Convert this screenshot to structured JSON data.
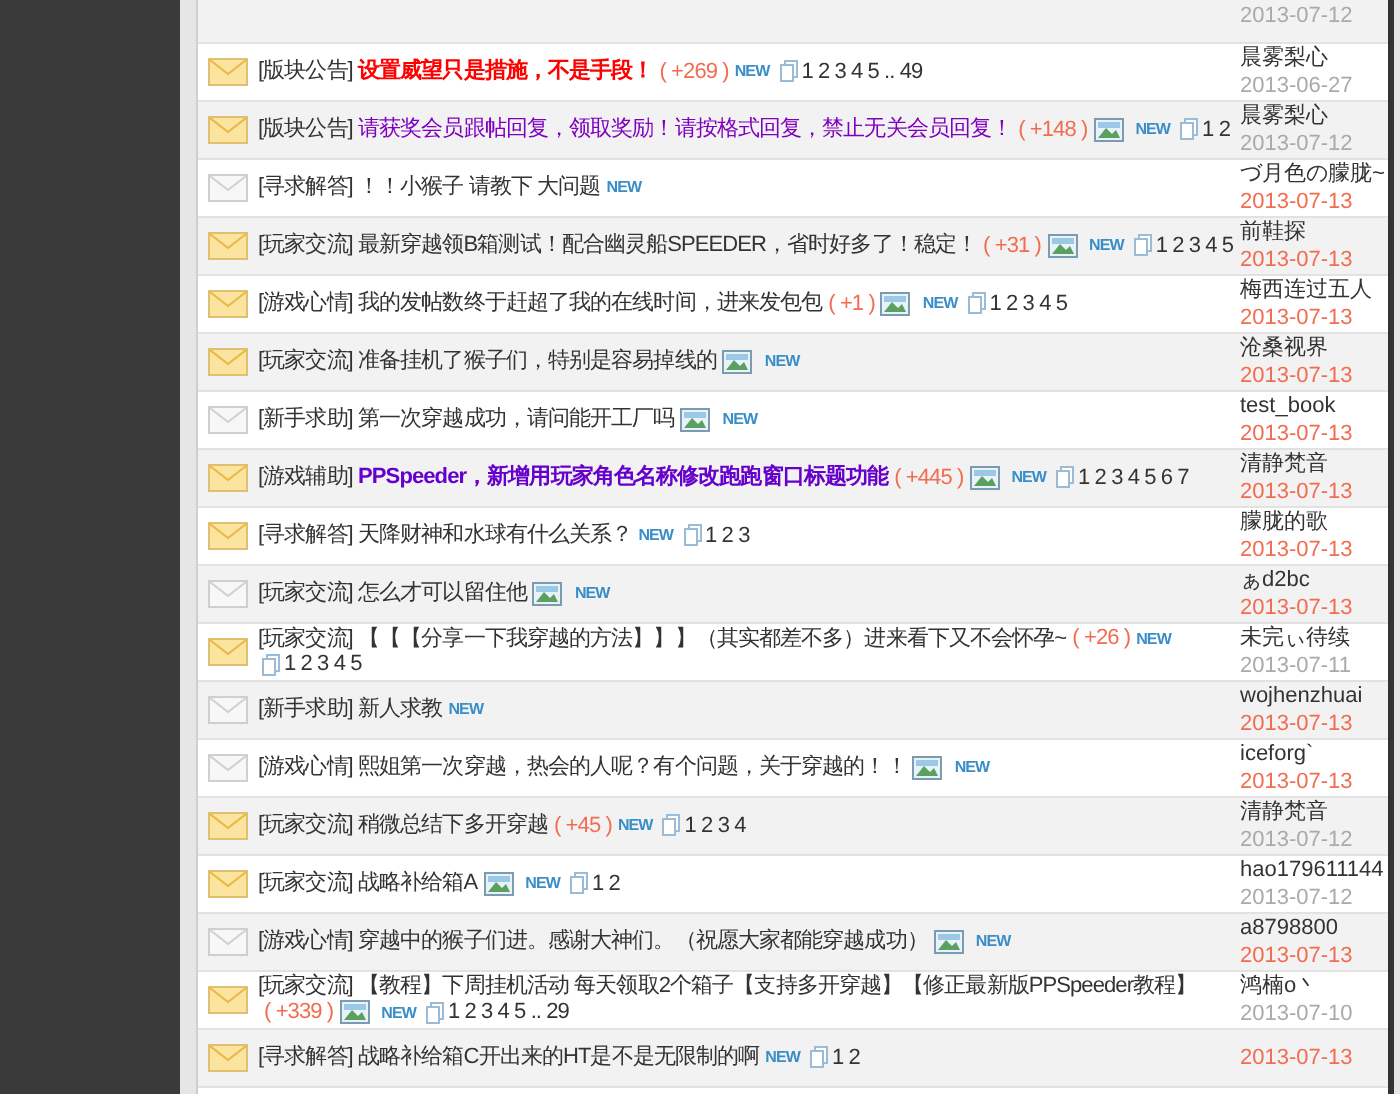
{
  "threads": [
    {
      "kind": "partial",
      "date": "2013-07-12",
      "recent": false
    },
    {
      "kind": "hot",
      "category": "[版块公告]",
      "title": "设置威望只是措施，不是手段！",
      "color": "#ff0000",
      "bold": true,
      "reward": "( +269 )",
      "new": "NEW",
      "pages": "1 2 3 4 5 .. 49",
      "author": "晨雾梨心",
      "date": "2013-06-27",
      "recent": false
    },
    {
      "kind": "hot",
      "category": "[版块公告]",
      "title": "请获奖会员跟帖回复，领取奖励！请按格式回复，禁止无关会员回复！",
      "color": "#8000c0",
      "reward": "( +148 )",
      "image": true,
      "new": "NEW",
      "pages": "1 2",
      "author": "晨雾梨心",
      "date": "2013-07-12",
      "recent": false
    },
    {
      "kind": "plain",
      "category": "[寻求解答]",
      "title": "！！小猴子 请教下 大问题",
      "color": "#333333",
      "new": "NEW",
      "author": "づ月色の朦胧~",
      "date": "2013-07-13",
      "recent": true
    },
    {
      "kind": "hot",
      "category": "[玩家交流]",
      "title": "最新穿越领B箱测试！配合幽灵船SPEEDER，省时好多了！稳定！",
      "color": "#333333",
      "reward": "( +31 )",
      "image": true,
      "new": "NEW",
      "pages": "1 2 3 4 5",
      "author": "前鞋探",
      "date": "2013-07-13",
      "recent": true
    },
    {
      "kind": "hot",
      "category": "[游戏心情]",
      "title": "我的发帖数终于赶超了我的在线时间，进来发包包",
      "color": "#333333",
      "reward": "( +1 )",
      "image": true,
      "new": "NEW",
      "pages": "1 2 3 4 5",
      "author": "梅西连过五人",
      "date": "2013-07-13",
      "recent": true
    },
    {
      "kind": "hot",
      "category": "[玩家交流]",
      "title": "准备挂机了猴子们，特别是容易掉线的",
      "color": "#333333",
      "image": true,
      "new": "NEW",
      "author": "沧桑视界",
      "date": "2013-07-13",
      "recent": true
    },
    {
      "kind": "plain",
      "category": "[新手求助]",
      "title": "第一次穿越成功，请问能开工厂吗",
      "color": "#333333",
      "image": true,
      "new": "NEW",
      "author": "test_book",
      "date": "2013-07-13",
      "recent": true
    },
    {
      "kind": "hot",
      "category": "[游戏辅助]",
      "title": "PPSpeeder，新增用玩家角色名称修改跑跑窗口标题功能",
      "color": "#6600cc",
      "bold": true,
      "reward": "( +445 )",
      "image": true,
      "new": "NEW",
      "pages": "1 2 3 4 5 6 7",
      "author": "清静梵音",
      "date": "2013-07-13",
      "recent": true
    },
    {
      "kind": "hot",
      "category": "[寻求解答]",
      "title": "天降财神和水球有什么关系？",
      "color": "#333333",
      "new": "NEW",
      "pages": "1 2 3",
      "author": "朦胧的歌",
      "date": "2013-07-13",
      "recent": true
    },
    {
      "kind": "plain",
      "category": "[玩家交流]",
      "title": "怎么才可以留住他",
      "color": "#333333",
      "image": true,
      "new": "NEW",
      "author": "ぁd2bc",
      "date": "2013-07-13",
      "recent": true
    },
    {
      "kind": "hot",
      "category": "[玩家交流]",
      "title": "【【【分享一下我穿越的方法】】】（其实都差不多）进来看下又不会怀孕~",
      "color": "#333333",
      "reward": "( +26 )",
      "new": "NEW",
      "pages": "1 2 3 4 5",
      "author": "未完ぃ待续",
      "date": "2013-07-11",
      "recent": false
    },
    {
      "kind": "plain",
      "category": "[新手求助]",
      "title": "新人求教",
      "color": "#333333",
      "new": "NEW",
      "author": "wojhenzhuai",
      "date": "2013-07-13",
      "recent": true
    },
    {
      "kind": "plain",
      "category": "[游戏心情]",
      "title": "熙姐第一次穿越，热会的人呢？有个问题，关于穿越的！！",
      "color": "#333333",
      "image": true,
      "new": "NEW",
      "author": "iceforg`",
      "date": "2013-07-13",
      "recent": true
    },
    {
      "kind": "hot",
      "category": "[玩家交流]",
      "title": "稍微总结下多开穿越",
      "color": "#333333",
      "reward": "( +45 )",
      "new": "NEW",
      "pages": "1 2 3 4",
      "author": "清静梵音",
      "date": "2013-07-12",
      "recent": false
    },
    {
      "kind": "hot",
      "category": "[玩家交流]",
      "title": "战略补给箱A",
      "color": "#333333",
      "image": true,
      "new": "NEW",
      "pages": "1 2",
      "author": "hao179611144",
      "date": "2013-07-12",
      "recent": false
    },
    {
      "kind": "plain",
      "category": "[游戏心情]",
      "title": "穿越中的猴子们进。感谢大神们。（祝愿大家都能穿越成功）",
      "color": "#333333",
      "image": true,
      "new": "NEW",
      "author": "a8798800",
      "date": "2013-07-13",
      "recent": true
    },
    {
      "kind": "hot",
      "category": "[玩家交流]",
      "title": "【教程】下周挂机活动  每天领取2个箱子【支持多开穿越】【修正最新版PPSpeeder教程】",
      "color": "#333333",
      "reward": "( +339 )",
      "image": true,
      "new": "NEW",
      "pages": "1 2 3 4 5 .. 29",
      "author": "鸿楠o丶",
      "date": "2013-07-10",
      "recent": false
    },
    {
      "kind": "hot",
      "category": "[寻求解答]",
      "title": "战略补给箱C开出来的HT是不是无限制的啊",
      "color": "#333333",
      "new": "NEW",
      "pages": "1 2",
      "date": "2013-07-13",
      "recent": true
    }
  ]
}
